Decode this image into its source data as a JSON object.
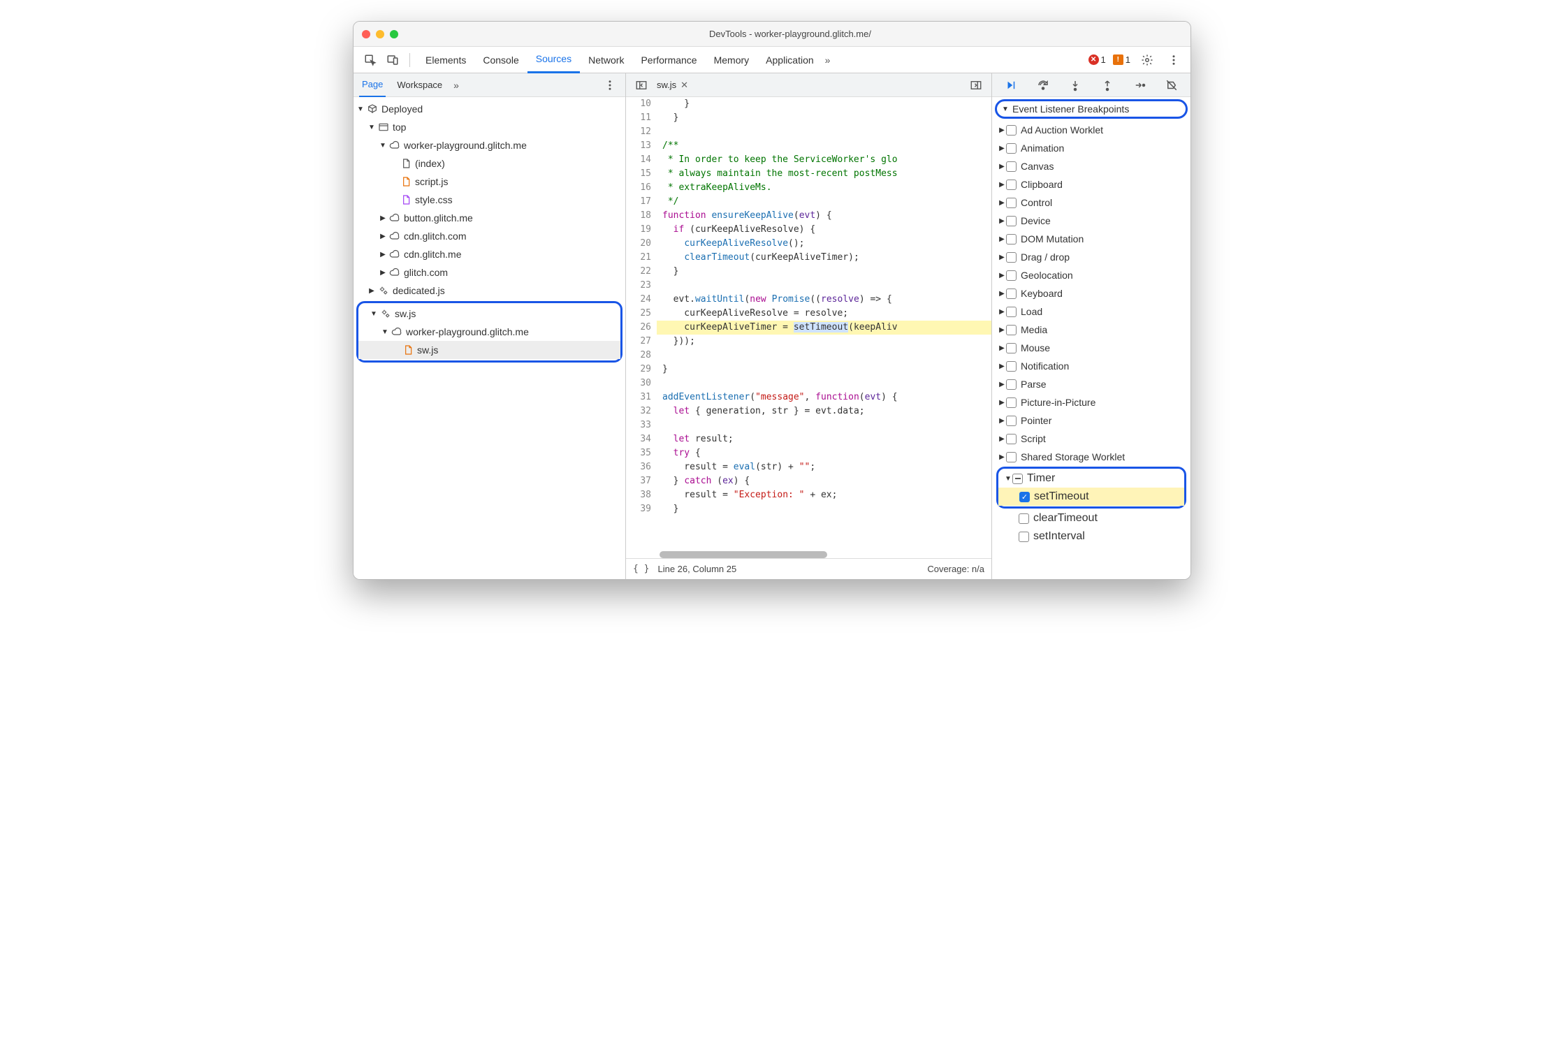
{
  "window_title": "DevTools - worker-playground.glitch.me/",
  "tabs": [
    "Elements",
    "Console",
    "Sources",
    "Network",
    "Performance",
    "Memory",
    "Application"
  ],
  "tabs_active": "Sources",
  "errors": "1",
  "warnings": "1",
  "left_tabs": {
    "page": "Page",
    "workspace": "Workspace"
  },
  "tree": {
    "deployed": "Deployed",
    "top": "top",
    "wp": "worker-playground.glitch.me",
    "index": "(index)",
    "script": "script.js",
    "style": "style.css",
    "button": "button.glitch.me",
    "cdn1": "cdn.glitch.com",
    "cdn2": "cdn.glitch.me",
    "glitch": "glitch.com",
    "dedicated": "dedicated.js",
    "sw": "sw.js",
    "wp2": "worker-playground.glitch.me",
    "swfile": "sw.js"
  },
  "open_file": "sw.js",
  "code_lines": [
    {
      "n": 10,
      "html": "    }"
    },
    {
      "n": 11,
      "html": "  }"
    },
    {
      "n": 12,
      "html": ""
    },
    {
      "n": 13,
      "html": "<span class='cmt'>/**</span>"
    },
    {
      "n": 14,
      "html": "<span class='cmt'> * In order to keep the ServiceWorker's glo</span>"
    },
    {
      "n": 15,
      "html": "<span class='cmt'> * always maintain the most-recent postMess</span>"
    },
    {
      "n": 16,
      "html": "<span class='cmt'> * extraKeepAliveMs.</span>"
    },
    {
      "n": 17,
      "html": "<span class='cmt'> */</span>"
    },
    {
      "n": 18,
      "html": "<span class='kw'>function</span> <span class='fn'>ensureKeepAlive</span>(<span class='prm'>evt</span>) {"
    },
    {
      "n": 19,
      "html": "  <span class='kw'>if</span> (curKeepAliveResolve) {"
    },
    {
      "n": 20,
      "html": "    <span class='fn'>curKeepAliveResolve</span>();"
    },
    {
      "n": 21,
      "html": "    <span class='fn'>clearTimeout</span>(curKeepAliveTimer);"
    },
    {
      "n": 22,
      "html": "  }"
    },
    {
      "n": 23,
      "html": ""
    },
    {
      "n": 24,
      "html": "  evt.<span class='fn'>waitUntil</span>(<span class='kw'>new</span> <span class='fn'>Promise</span>((<span class='prm'>resolve</span>) =&gt; {"
    },
    {
      "n": 25,
      "html": "    curKeepAliveResolve = resolve;"
    },
    {
      "n": 26,
      "html": "    curKeepAliveTimer = <span class='sel-blue'>setTimeout</span>(keepAliv",
      "hl": true
    },
    {
      "n": 27,
      "html": "  }));"
    },
    {
      "n": 28,
      "html": ""
    },
    {
      "n": 29,
      "html": "}"
    },
    {
      "n": 30,
      "html": ""
    },
    {
      "n": 31,
      "html": "<span class='fn'>addEventListener</span>(<span class='str'>\"message\"</span>, <span class='kw'>function</span>(<span class='prm'>evt</span>) {"
    },
    {
      "n": 32,
      "html": "  <span class='kw'>let</span> { generation, str } = evt.data;"
    },
    {
      "n": 33,
      "html": ""
    },
    {
      "n": 34,
      "html": "  <span class='kw'>let</span> result;"
    },
    {
      "n": 35,
      "html": "  <span class='kw'>try</span> {"
    },
    {
      "n": 36,
      "html": "    result = <span class='fn'>eval</span>(str) + <span class='str'>\"\"</span>;"
    },
    {
      "n": 37,
      "html": "  } <span class='kw'>catch</span> (<span class='prm'>ex</span>) {"
    },
    {
      "n": 38,
      "html": "    result = <span class='str'>\"Exception: \"</span> + ex;"
    },
    {
      "n": 39,
      "html": "  }"
    }
  ],
  "cursor_position": "Line 26, Column 25",
  "coverage": "Coverage: n/a",
  "panel_title": "Event Listener Breakpoints",
  "bp_categories": [
    "Ad Auction Worklet",
    "Animation",
    "Canvas",
    "Clipboard",
    "Control",
    "Device",
    "DOM Mutation",
    "Drag / drop",
    "Geolocation",
    "Keyboard",
    "Load",
    "Media",
    "Mouse",
    "Notification",
    "Parse",
    "Picture-in-Picture",
    "Pointer",
    "Script",
    "Shared Storage Worklet"
  ],
  "timer_label": "Timer",
  "timer_children": {
    "setTimeout": "setTimeout",
    "clearTimeout": "clearTimeout",
    "setInterval": "setInterval"
  }
}
